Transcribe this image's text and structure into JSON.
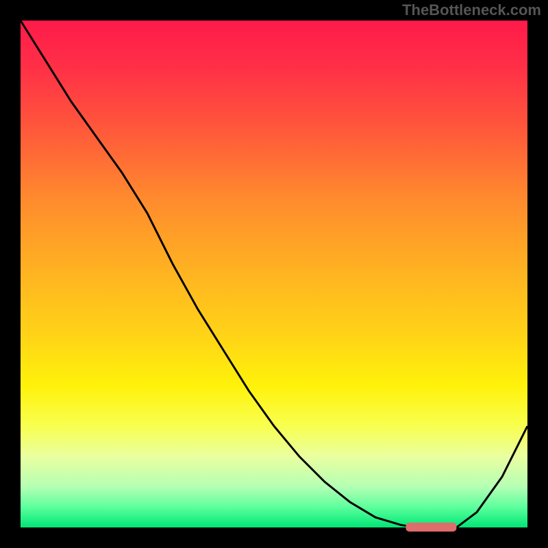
{
  "watermark": "TheBottleneck.com",
  "colors": {
    "frame": "#000000",
    "curve": "#000000",
    "marker": "#de6d6c",
    "gradient_stops": [
      {
        "offset": 0.0,
        "color": "#ff1a4a"
      },
      {
        "offset": 0.1,
        "color": "#ff3246"
      },
      {
        "offset": 0.22,
        "color": "#ff5a3a"
      },
      {
        "offset": 0.35,
        "color": "#ff8a2e"
      },
      {
        "offset": 0.5,
        "color": "#ffb421"
      },
      {
        "offset": 0.62,
        "color": "#ffd317"
      },
      {
        "offset": 0.72,
        "color": "#fff20a"
      },
      {
        "offset": 0.8,
        "color": "#f8ff4f"
      },
      {
        "offset": 0.86,
        "color": "#eaffa0"
      },
      {
        "offset": 0.92,
        "color": "#b4ffb4"
      },
      {
        "offset": 0.96,
        "color": "#5cff9c"
      },
      {
        "offset": 1.0,
        "color": "#00e676"
      }
    ]
  },
  "chart_data": {
    "type": "line",
    "title": "",
    "xlabel": "",
    "ylabel": "",
    "x": [
      0.0,
      0.05,
      0.1,
      0.15,
      0.2,
      0.25,
      0.3,
      0.35,
      0.4,
      0.45,
      0.5,
      0.55,
      0.6,
      0.65,
      0.7,
      0.75,
      0.78,
      0.82,
      0.86,
      0.9,
      0.95,
      1.0
    ],
    "values": [
      1.0,
      0.92,
      0.84,
      0.77,
      0.7,
      0.62,
      0.52,
      0.43,
      0.35,
      0.27,
      0.2,
      0.14,
      0.09,
      0.05,
      0.02,
      0.005,
      0.0,
      0.0,
      0.0,
      0.03,
      0.1,
      0.2
    ],
    "xlim": [
      0,
      1
    ],
    "ylim": [
      0,
      1
    ],
    "marker": {
      "x_range": [
        0.76,
        0.86
      ],
      "y": 0.0
    }
  }
}
